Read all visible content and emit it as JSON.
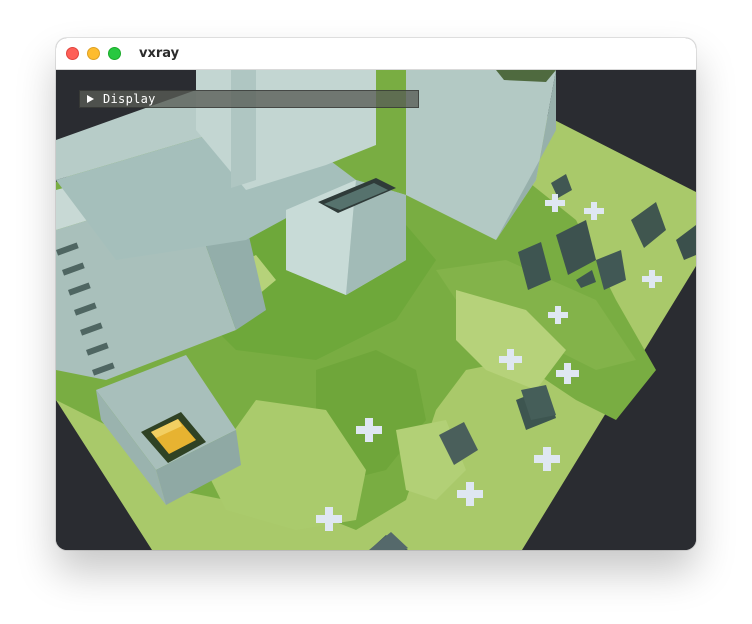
{
  "window": {
    "title": "vxray"
  },
  "debug_panel": {
    "label": "Display",
    "expand_icon": "triangle-right-icon",
    "expanded": false
  },
  "scene": {
    "description_free": true,
    "colors": {
      "background": "#2a2c31",
      "ground": "#a9c96a",
      "ground_shadow": "#73a93c",
      "building": "#b8cbc6",
      "pillar": "#3e5551",
      "flower": "#dce4f0",
      "yellow_block": "#e7b331"
    }
  }
}
